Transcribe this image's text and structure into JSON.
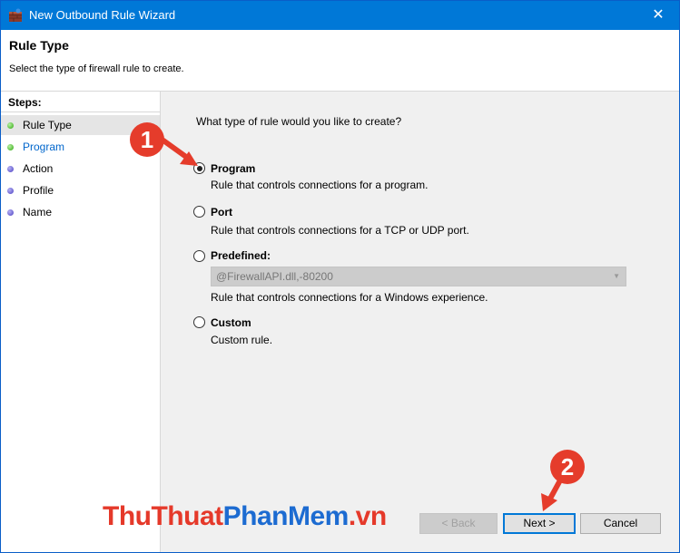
{
  "window": {
    "title": "New Outbound Rule Wizard",
    "close_glyph": "✕"
  },
  "header": {
    "title": "Rule Type",
    "subtitle": "Select the type of firewall rule to create."
  },
  "steps": {
    "label": "Steps:",
    "items": [
      {
        "label": "Rule Type",
        "status": "done",
        "color": "#2ea80e"
      },
      {
        "label": "Program",
        "status": "current",
        "color": "#2ea80e"
      },
      {
        "label": "Action",
        "status": "pending",
        "color": "#4b3fc2"
      },
      {
        "label": "Profile",
        "status": "pending",
        "color": "#4b3fc2"
      },
      {
        "label": "Name",
        "status": "pending",
        "color": "#4b3fc2"
      }
    ]
  },
  "main": {
    "question": "What type of rule would you like to create?",
    "options": [
      {
        "label": "Program",
        "description": "Rule that controls connections for a program.",
        "selected": true
      },
      {
        "label": "Port",
        "description": "Rule that controls connections for a TCP or UDP port.",
        "selected": false
      },
      {
        "label": "Predefined:",
        "description": "Rule that controls connections for a Windows experience.",
        "selected": false
      },
      {
        "label": "Custom",
        "description": "Custom rule.",
        "selected": false
      }
    ],
    "predefined_value": "@FirewallAPI.dll,-80200"
  },
  "buttons": {
    "back": "< Back",
    "next": "Next >",
    "cancel": "Cancel"
  },
  "annotations": {
    "badge1": "1",
    "badge2": "2",
    "color": "#e53c2b"
  },
  "watermark": {
    "part1": "ThuThuat",
    "part2": "PhanMem",
    "part3": ".vn"
  }
}
